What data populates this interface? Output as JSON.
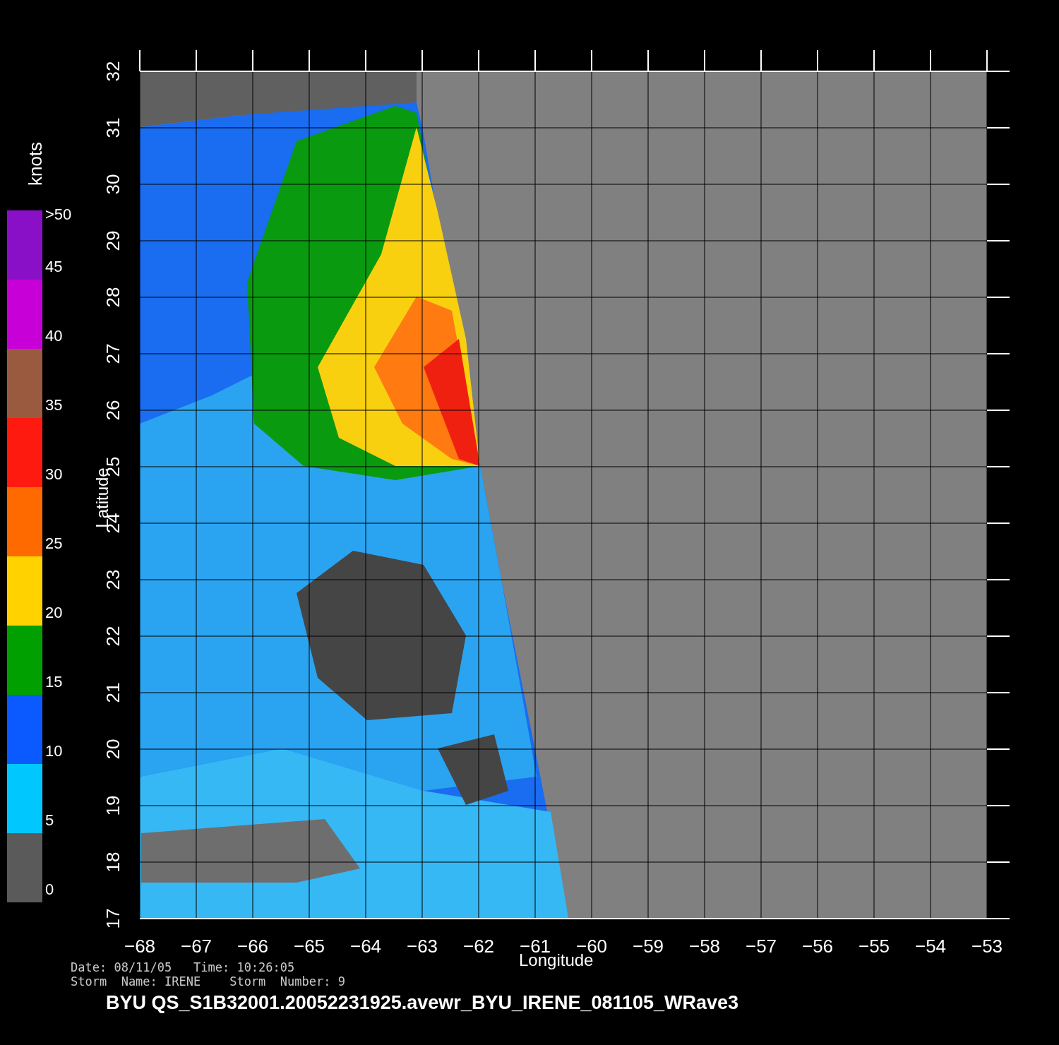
{
  "map": {
    "xlabel": "Longitude",
    "ylabel": "Latitude",
    "xticks": [
      "−68",
      "−67",
      "−66",
      "−65",
      "−64",
      "−63",
      "−62",
      "−61",
      "−60",
      "−59",
      "−58",
      "−57",
      "−56",
      "−55",
      "−54",
      "−53"
    ],
    "yticks": [
      "17",
      "18",
      "19",
      "20",
      "21",
      "22",
      "23",
      "24",
      "25",
      "26",
      "27",
      "28",
      "29",
      "30",
      "31",
      "32"
    ]
  },
  "colorbar": {
    "unit": "knots",
    "top_label": ">50",
    "bands": [
      {
        "label": "45",
        "color": "#8a10c8"
      },
      {
        "label": "40",
        "color": "#c800d8"
      },
      {
        "label": "35",
        "color": "#9a5a40"
      },
      {
        "label": "30",
        "color": "#ff1a10"
      },
      {
        "label": "25",
        "color": "#ff6a00"
      },
      {
        "label": "20",
        "color": "#ffd200"
      },
      {
        "label": "15",
        "color": "#00a000"
      },
      {
        "label": "10",
        "color": "#0a5aff"
      },
      {
        "label": "5",
        "color": "#00c8ff"
      },
      {
        "label": "0",
        "color": "#5a5a5a"
      }
    ]
  },
  "info": {
    "date_line": "Date: 08/11/05   Time: 10:26:05",
    "storm_line": "Storm  Name: IRENE    Storm  Number: 9"
  },
  "title": "BYU  QS_S1B32001.20052231925.avewr_BYU_IRENE_081105_WRave3"
}
